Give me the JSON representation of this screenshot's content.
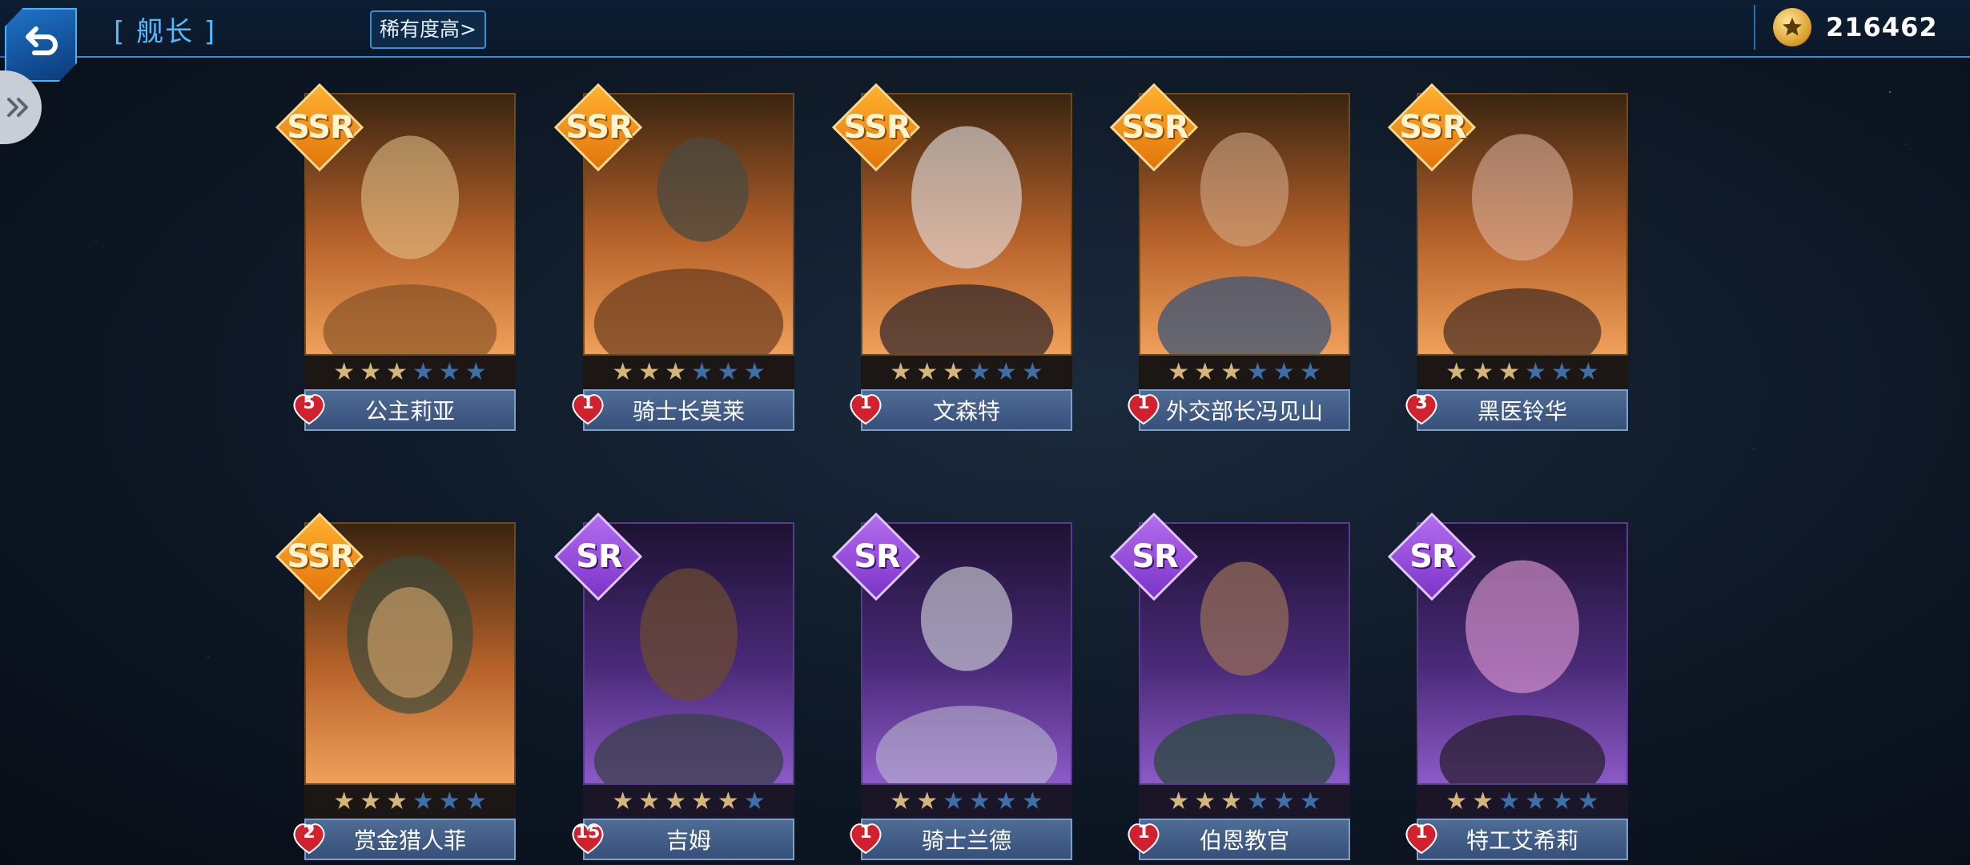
{
  "header": {
    "title": "[ 舰长 ]",
    "sort_label": "稀有度高>",
    "currency_value": "216462"
  },
  "icons": {
    "back": "return-arrow-icon",
    "side": "double-chevron-icon",
    "currency": "star-coin-icon",
    "level": "heart-icon"
  },
  "colors": {
    "accent": "#3a8fd4",
    "ssr": "#f39a1e",
    "sr": "#9b4fe0",
    "star_on": "#d4b57a",
    "star_off": "#3e6fa8"
  },
  "cards": [
    {
      "name": "公主莉亚",
      "rarity": "SSR",
      "level": "5",
      "stars": 3
    },
    {
      "name": "骑士长莫莱",
      "rarity": "SSR",
      "level": "1",
      "stars": 3
    },
    {
      "name": "文森特",
      "rarity": "SSR",
      "level": "1",
      "stars": 3
    },
    {
      "name": "外交部长冯见山",
      "rarity": "SSR",
      "level": "1",
      "stars": 3
    },
    {
      "name": "黑医铃华",
      "rarity": "SSR",
      "level": "3",
      "stars": 3
    },
    {
      "name": "赏金猎人菲",
      "rarity": "SSR",
      "level": "2",
      "stars": 3
    },
    {
      "name": "吉姆",
      "rarity": "SR",
      "level": "15",
      "stars": 5
    },
    {
      "name": "骑士兰德",
      "rarity": "SR",
      "level": "1",
      "stars": 2
    },
    {
      "name": "伯恩教官",
      "rarity": "SR",
      "level": "1",
      "stars": 3
    },
    {
      "name": "特工艾希莉",
      "rarity": "SR",
      "level": "1",
      "stars": 2
    }
  ]
}
